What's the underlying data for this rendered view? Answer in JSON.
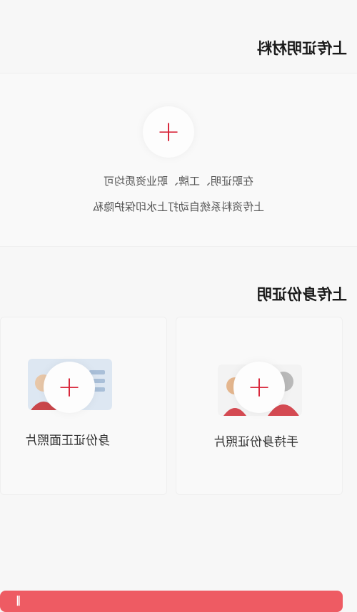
{
  "sections": {
    "materials_title": "上传证明材料",
    "id_title": "上传身份证明"
  },
  "materials": {
    "plus_icon": "plus-icon",
    "hint_line1": "在职证明、工牌、职业资质均可",
    "hint_line2": "上传资料系统自动打上水印保护隐私"
  },
  "id_cards": {
    "front_label": "身份证正面照片",
    "hold_label": "手持身份证照片"
  },
  "colors": {
    "accent": "#d8263a",
    "button": "#ee5b63",
    "background": "#f7f7f7"
  }
}
